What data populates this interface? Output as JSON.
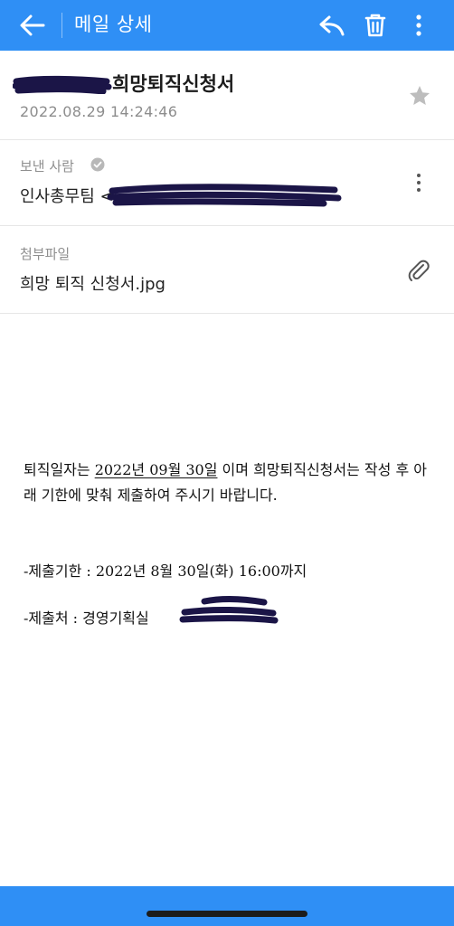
{
  "app_bar": {
    "title": "메일 상세",
    "icons": [
      "back-arrow-icon",
      "reply-icon",
      "trash-icon",
      "more-vertical-icon"
    ]
  },
  "mail": {
    "subject": "희망퇴직신청서",
    "datetime": "2022.08.29 14:24:46",
    "starred": false
  },
  "sender": {
    "label": "보낸 사람",
    "name": "인사총무팀 <"
  },
  "attachment": {
    "label": "첨부파일",
    "file_name": "희망 퇴직 신청서.jpg"
  },
  "body": {
    "p1_pre": " 퇴직일자는 ",
    "p1_date": "2022년 09월 30일",
    "p1_post": " 이며 희망퇴직신청서는 작성 후 아래 기한에 맞춰 제출하여 주시기 바랍니다.",
    "deadline": "-제출기한 : 2022년 8월 30일(화) 16:00까지",
    "submit_to": "-제출처 : 경영기획실"
  },
  "colors": {
    "accent": "#2f8ff5",
    "redaction": "#1b1547"
  }
}
